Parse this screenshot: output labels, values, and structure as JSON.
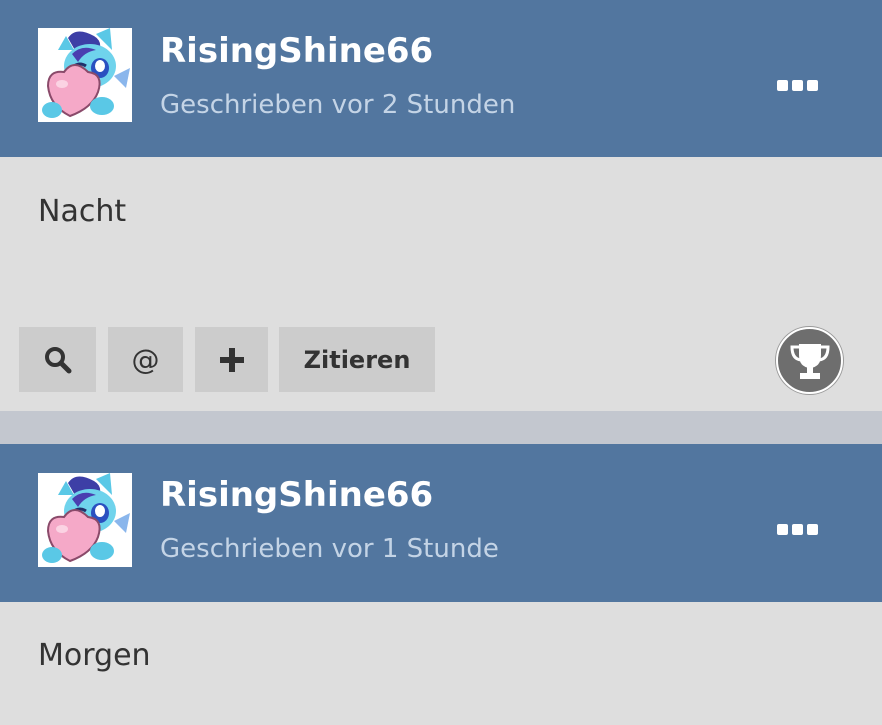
{
  "posts": [
    {
      "username": "RisingShine66",
      "timestamp": "Geschrieben vor 2 Stunden",
      "text": "Nacht",
      "avatar_icon": "pony-with-heart-avatar",
      "more_icon": "more-dots-icon"
    },
    {
      "username": "RisingShine66",
      "timestamp": "Geschrieben vor 1 Stunde",
      "text": "Morgen",
      "avatar_icon": "pony-with-heart-avatar",
      "more_icon": "more-dots-icon"
    }
  ],
  "actions": {
    "search_icon": "search-icon",
    "mention_label": "@",
    "add_icon": "plus-icon",
    "quote_label": "Zitieren",
    "trophy_icon": "trophy-icon"
  },
  "colors": {
    "header_bg": "#52769f",
    "body_bg": "#dedede",
    "button_bg": "#cccccc",
    "separator": "#c3c7cf",
    "timestamp": "#c4d4e6"
  }
}
